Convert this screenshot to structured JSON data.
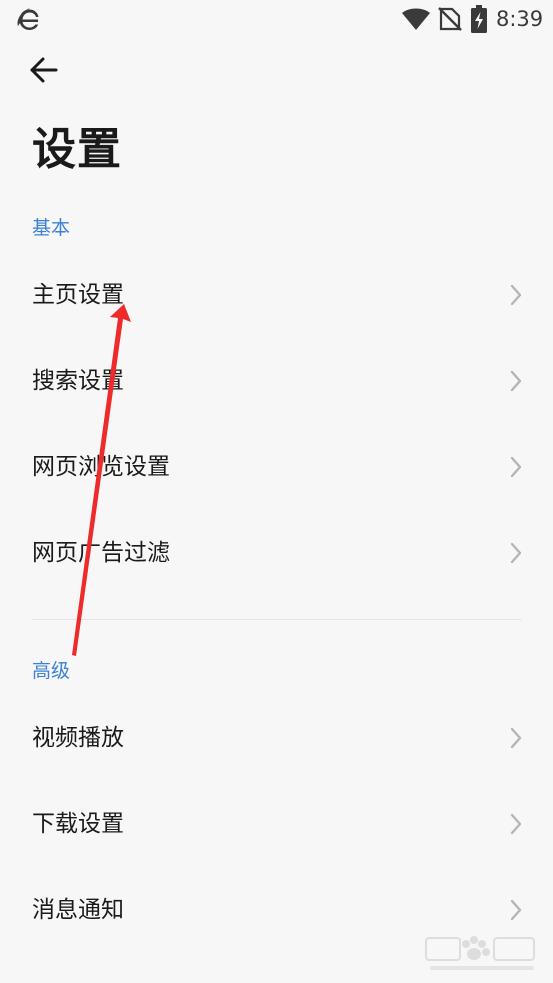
{
  "status_bar": {
    "time": "8:39",
    "app_icon": "browser-e-icon",
    "wifi_icon": "wifi-icon",
    "signal_icon": "no-signal-icon",
    "battery_icon": "battery-charging-icon"
  },
  "header": {
    "back_icon": "back-arrow-icon",
    "title": "设置"
  },
  "sections": [
    {
      "header": "基本",
      "items": [
        {
          "label": "主页设置"
        },
        {
          "label": "搜索设置"
        },
        {
          "label": "网页浏览设置"
        },
        {
          "label": "网页广告过滤"
        }
      ]
    },
    {
      "header": "高级",
      "items": [
        {
          "label": "视频播放"
        },
        {
          "label": "下载设置"
        },
        {
          "label": "消息通知"
        }
      ]
    }
  ],
  "colors": {
    "background": "#f7f7f7",
    "accent": "#3b82d6",
    "text": "#1a1a1a",
    "chevron": "#b5b5b5",
    "annotation_arrow": "#ee2a2a"
  },
  "icons": {
    "chevron": "chevron-right-icon"
  }
}
